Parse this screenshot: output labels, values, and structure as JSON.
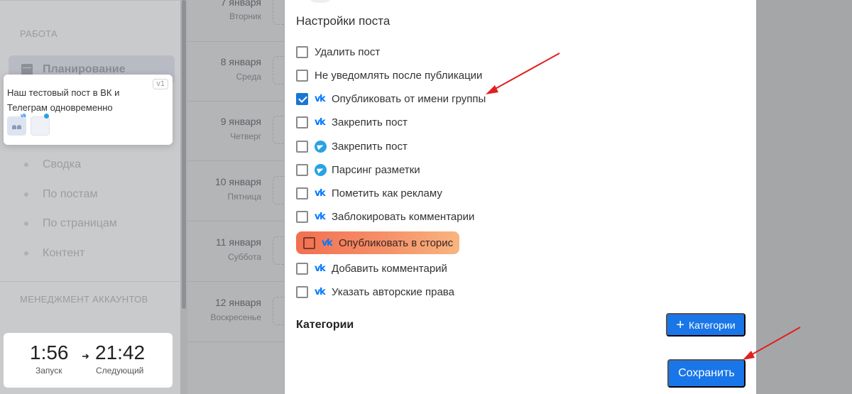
{
  "sidebar": {
    "section_work": "РАБОТА",
    "active_item": "Планирование",
    "items": [
      {
        "label": "Сводка"
      },
      {
        "label": "По постам"
      },
      {
        "label": "По страницам"
      },
      {
        "label": "Контент"
      }
    ],
    "section_accounts": "МЕНЕДЖМЕНТ АККАУНТОВ"
  },
  "calendar": {
    "days": [
      {
        "date": "7 января",
        "weekday": "Вторник"
      },
      {
        "date": "8 января",
        "weekday": "Среда"
      },
      {
        "date": "9 января",
        "weekday": "Четверг"
      },
      {
        "date": "10 января",
        "weekday": "Пятница"
      },
      {
        "date": "11 января",
        "weekday": "Суббота"
      },
      {
        "date": "12 января",
        "weekday": "Воскресенье"
      }
    ]
  },
  "post_card": {
    "version": "v1",
    "text": "Наш тестовый пост в ВК и Телеграм одновременно"
  },
  "timer": {
    "launch_time": "1:56",
    "launch_label": "Запуск",
    "next_time": "21:42",
    "next_label": "Следующий",
    "arrow": "➜"
  },
  "modal": {
    "title": "Настройки поста",
    "options": [
      {
        "label": "Удалить пост",
        "network": "",
        "checked": false
      },
      {
        "label": "Не уведомлять после публикации",
        "network": "",
        "checked": false
      },
      {
        "label": "Опубликовать от имени группы",
        "network": "vk",
        "checked": true
      },
      {
        "label": "Закрепить пост",
        "network": "vk",
        "checked": false
      },
      {
        "label": "Закрепить пост",
        "network": "telegram",
        "checked": false
      },
      {
        "label": "Парсинг разметки",
        "network": "telegram",
        "checked": false
      },
      {
        "label": "Пометить как рекламу",
        "network": "vk",
        "checked": false
      },
      {
        "label": "Заблокировать комментарии",
        "network": "vk",
        "checked": false
      },
      {
        "label": "Опубликовать в сторис",
        "network": "vk",
        "checked": false,
        "highlighted": true
      },
      {
        "label": "Добавить комментарий",
        "network": "vk",
        "checked": false
      },
      {
        "label": "Указать авторские права",
        "network": "vk",
        "checked": false
      }
    ],
    "categories_label": "Категории",
    "categories_button": "Категории",
    "save_button": "Сохранить"
  },
  "icons": {
    "vk": "vk-icon",
    "telegram": "telegram-icon",
    "check": "check-icon",
    "plus": "plus-icon",
    "calendar": "calendar-icon"
  },
  "colors": {
    "primary": "#1976e8",
    "vk": "#0077ff",
    "telegram": "#2aa2e0",
    "highlight_start": "#f26f50",
    "highlight_end": "#f8b57f",
    "annotation_arrow": "#e02020"
  }
}
